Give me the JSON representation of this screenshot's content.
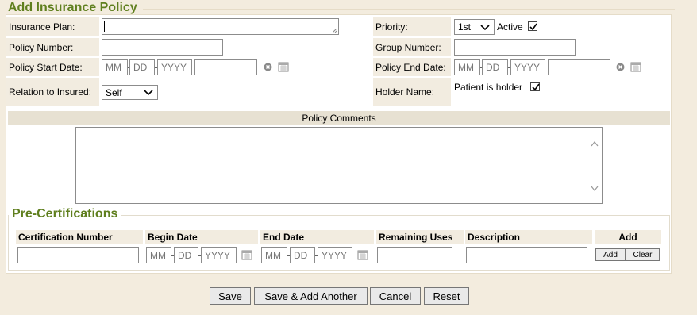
{
  "form": {
    "title": "Add Insurance Policy",
    "fields": {
      "insurance_plan_label": "Insurance Plan:",
      "policy_number_label": "Policy Number:",
      "policy_start_label": "Policy Start Date:",
      "relation_label": "Relation to Insured:",
      "relation_value": "Self",
      "priority_label": "Priority:",
      "priority_value": "1st",
      "active_label": "Active",
      "group_number_label": "Group Number:",
      "policy_end_label": "Policy End Date:",
      "holder_name_label": "Holder Name:",
      "patient_holder_label": "Patient is holder"
    },
    "date_placeholders": {
      "month": "MM",
      "day": "DD",
      "year": "YYYY"
    },
    "comments_header": "Policy Comments"
  },
  "precert": {
    "title": "Pre-Certifications",
    "columns": [
      "Certification Number",
      "Begin Date",
      "End Date",
      "Remaining Uses",
      "Description",
      "Add"
    ],
    "add_label": "Add",
    "clear_label": "Clear"
  },
  "buttons": {
    "save": "Save",
    "save_add": "Save & Add Another",
    "cancel": "Cancel",
    "reset": "Reset"
  },
  "colors": {
    "accent_green": "#5f7f1e",
    "background": "#f3ecde"
  }
}
